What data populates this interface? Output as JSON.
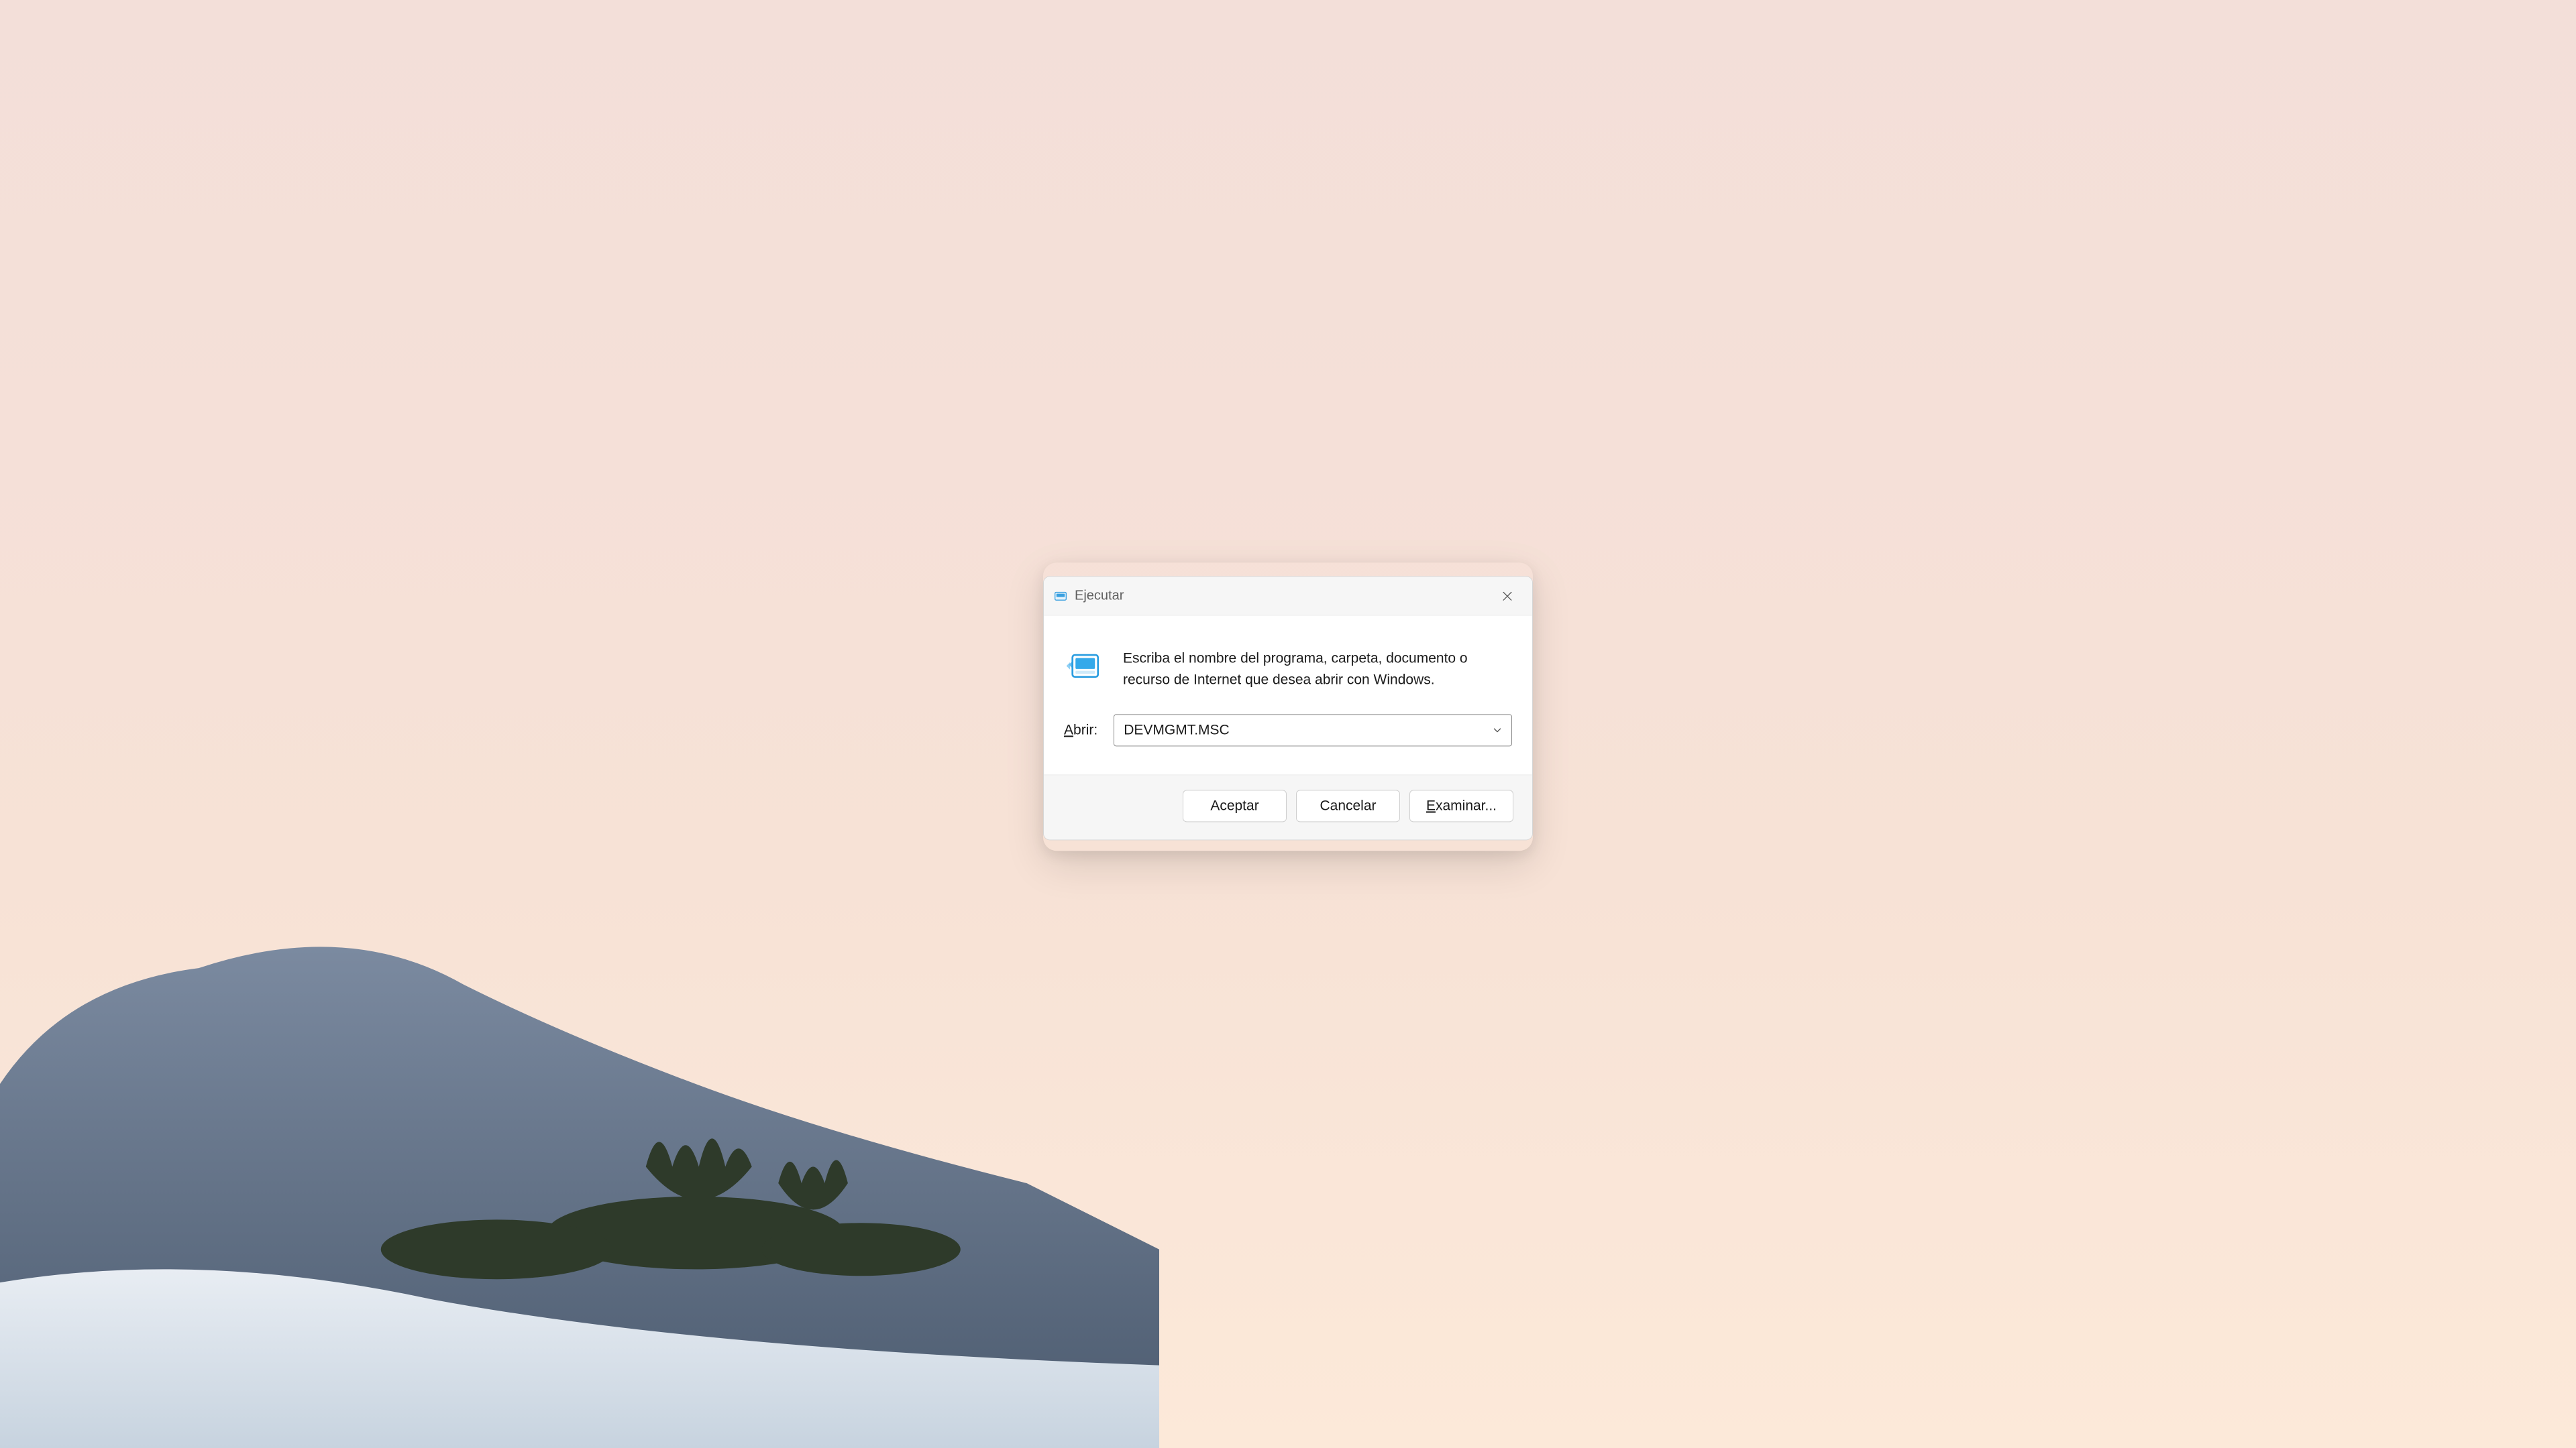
{
  "dialog": {
    "title": "Ejecutar",
    "description": "Escriba el nombre del programa, carpeta, documento o recurso de Internet que desea abrir con Windows.",
    "open_label_pre": "A",
    "open_label_rest": "brir:",
    "input_value": "DEVMGMT.MSC",
    "buttons": {
      "ok": "Aceptar",
      "cancel": "Cancelar",
      "browse_pre": "E",
      "browse_rest": "xaminar..."
    },
    "icons": {
      "title_icon": "run-icon",
      "big_icon": "run-icon-large",
      "close": "close-icon",
      "chevron": "chevron-down-icon"
    }
  }
}
